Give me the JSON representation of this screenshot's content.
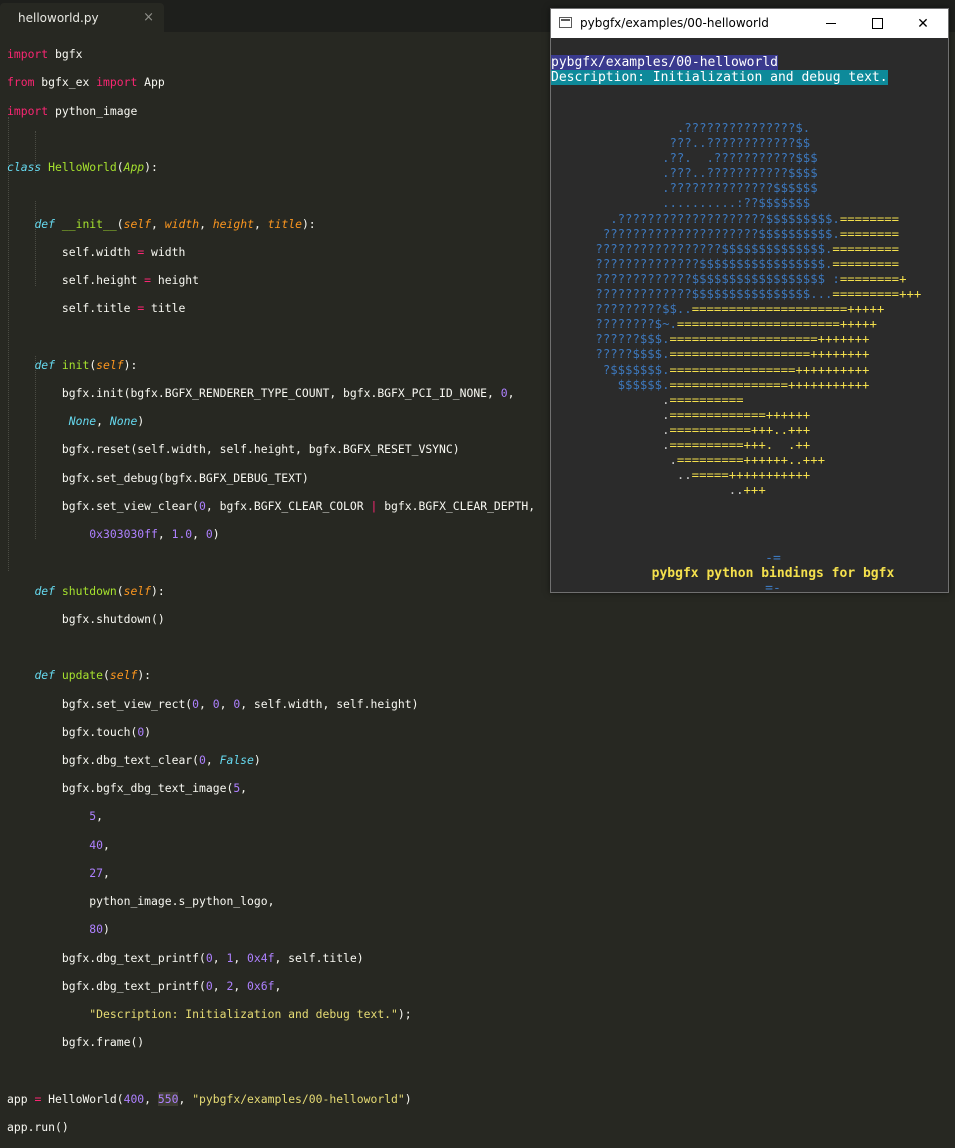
{
  "editor": {
    "tab": {
      "filename": "helloworld.py",
      "close": "×"
    }
  },
  "window": {
    "title": "pybgfx/examples/00-helloworld",
    "controls": {
      "minimize": "",
      "maximize": "",
      "close": "✕"
    },
    "debug_title": "pybgfx/examples/00-helloworld",
    "debug_description": "Description: Initialization and debug text.",
    "logo_rows": [
      "                 .???????????????$.",
      "                ???..????????????$$",
      "               .??.  .???????????$$$",
      "               .???..???????????$$$$",
      "               .??????????????$$$$$$",
      "               ..........:??$$$$$$$",
      "        .????????????????????$$$$$$$$$.========",
      "       ?????????????????????$$$$$$$$$$.========",
      "      ?????????????????$$$$$$$$$$$$$$.=========",
      "      ??????????????$$$$$$$$$$$$$$$$$.=========",
      "      ?????????????$$$$$$$$$$$$$$$$$$ :========+",
      "      ?????????????$$$$$$$$$$$$$$$$...=========+++",
      "      ?????????$$..=====================+++++",
      "      ????????$~.======================+++++",
      "      ??????$$$.====================+++++++",
      "      ?????$$$$.===================++++++++",
      "       ?$$$$$$$.=================++++++++++",
      "         $$$$$$.================+++++++++++",
      "               .==========",
      "               .=============++++++",
      "               .===========+++..+++",
      "               .==========+++.  .++",
      "                .=========++++++..+++",
      "                 ..=====+++++++++++",
      "                        ..+++"
    ],
    "footer_left": "-=",
    "footer_text": "pybgfx python bindings for bgfx",
    "footer_right": "=-"
  },
  "colors": {
    "editor_bg": "#272822",
    "keyword": "#f92672",
    "function": "#a6e22e",
    "storage": "#66d9ef",
    "parameter": "#fd971f",
    "number": "#ae81ff",
    "string": "#e6db74",
    "logo_blue": "#3d78bd",
    "logo_yellow": "#f4e04d"
  }
}
